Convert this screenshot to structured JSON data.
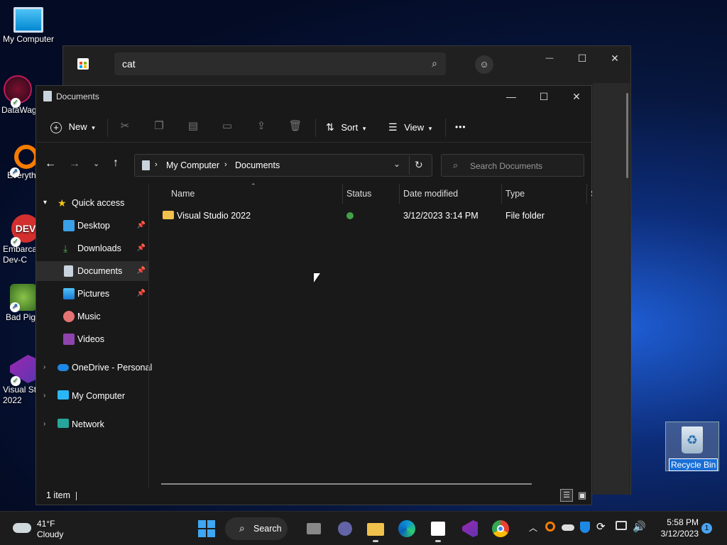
{
  "desktop": {
    "icons": [
      {
        "label": "My Computer"
      },
      {
        "label": "DataWag"
      },
      {
        "label": "Everyth"
      },
      {
        "label": "Embarca Dev-C"
      },
      {
        "label": "Bad Pig"
      },
      {
        "label": "Visual St 2022"
      }
    ],
    "recycle_bin": "Recycle Bin"
  },
  "store": {
    "search_value": "cat",
    "controls": {
      "minimize": "—",
      "maximize": "☐",
      "close": "✕"
    }
  },
  "explorer": {
    "title": "Documents",
    "toolbar": {
      "new": "New",
      "sort": "Sort",
      "view": "View",
      "more": "•••"
    },
    "address": {
      "root": "My Computer",
      "current": "Documents"
    },
    "search_placeholder": "Search Documents",
    "nav": {
      "quick_access": "Quick access",
      "desktop": "Desktop",
      "downloads": "Downloads",
      "documents": "Documents",
      "pictures": "Pictures",
      "music": "Music",
      "videos": "Videos",
      "onedrive": "OneDrive - Personal",
      "my_computer": "My Computer",
      "network": "Network"
    },
    "columns": {
      "name": "Name",
      "status": "Status",
      "date": "Date modified",
      "type": "Type",
      "size": "S"
    },
    "files": [
      {
        "name": "Visual Studio 2022",
        "date": "3/12/2023 3:14 PM",
        "type": "File folder"
      }
    ],
    "status_text": "1 item"
  },
  "taskbar": {
    "weather_temp": "41°F",
    "weather_desc": "Cloudy",
    "search_label": "Search",
    "time": "5:58 PM",
    "date": "3/12/2023",
    "notification_count": "1"
  }
}
